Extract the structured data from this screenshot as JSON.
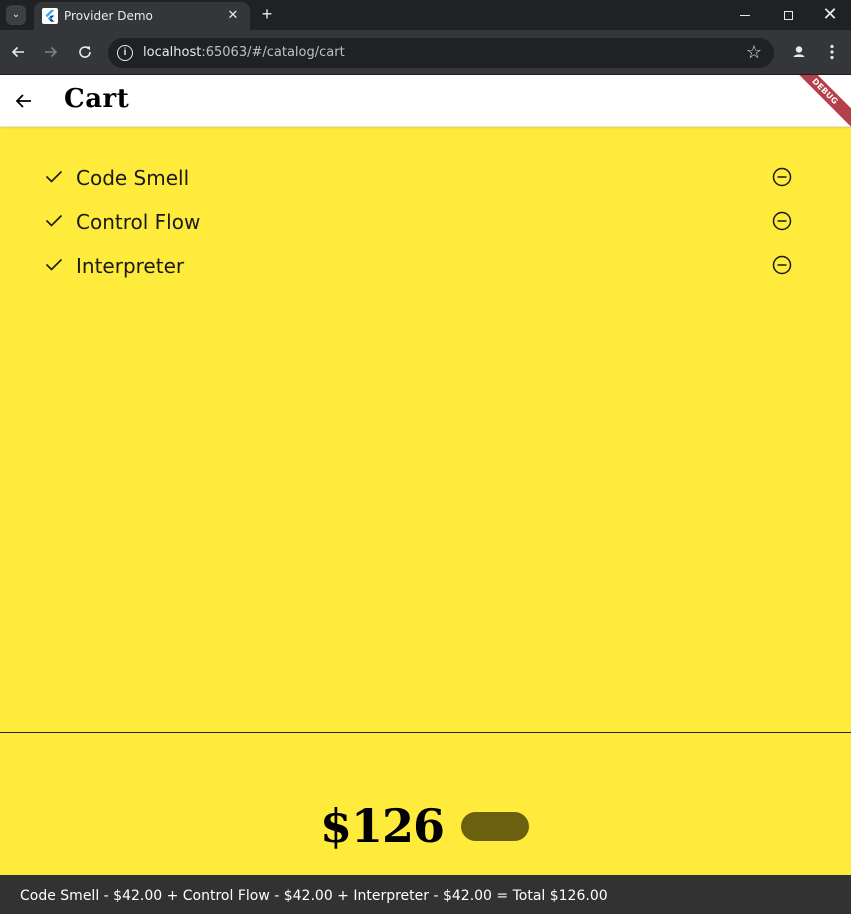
{
  "browser": {
    "tab_title": "Provider Demo",
    "tab_close": "✕",
    "new_tab": "+",
    "url_host": "localhost",
    "url_path": ":65063/#/catalog/cart",
    "win_close": "✕"
  },
  "appbar": {
    "title": "Cart",
    "debug_label": "DEBUG"
  },
  "cart": {
    "items": [
      {
        "name": "Code Smell"
      },
      {
        "name": "Control Flow"
      },
      {
        "name": "Interpreter"
      }
    ],
    "total": "$126"
  },
  "snackbar": {
    "message": "Code Smell - $42.00 + Control Flow - $42.00 + Interpreter - $42.00 = Total $126.00"
  },
  "colors": {
    "app_background": "#ffeb3b",
    "buy_button": "#6b6010",
    "debug_ribbon": "#b3404a"
  }
}
